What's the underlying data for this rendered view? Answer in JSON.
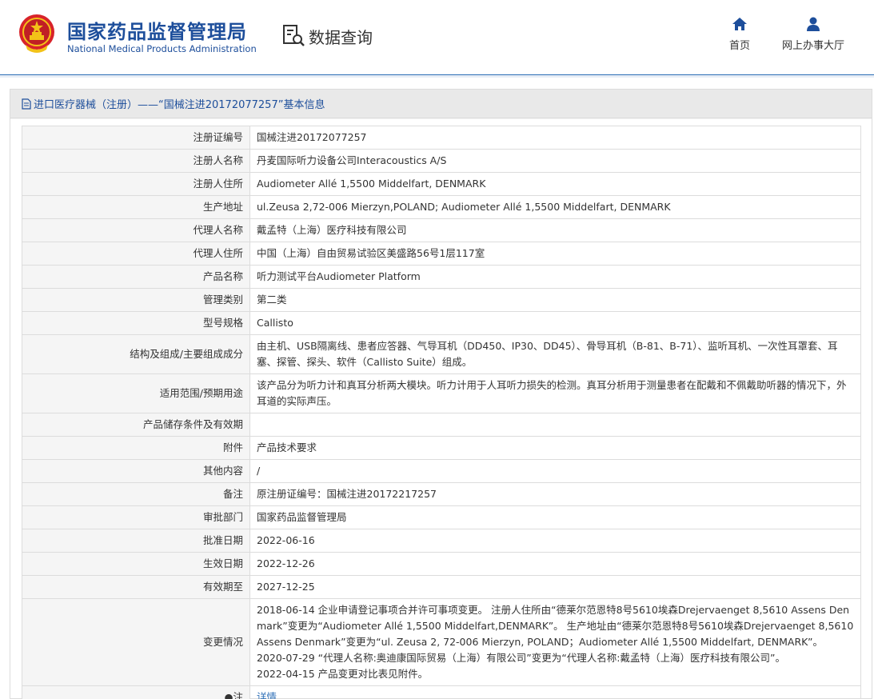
{
  "header": {
    "title_cn": "国家药品监督管理局",
    "title_en": "National Medical Products Administration",
    "query_label": "数据查询",
    "nav": [
      {
        "label": "首页",
        "icon": "home-icon"
      },
      {
        "label": "网上办事大厅",
        "icon": "user-icon"
      }
    ]
  },
  "panel": {
    "title": "进口医疗器械（注册）——“国械注进20172077257”基本信息"
  },
  "rows": [
    {
      "key": "注册证编号",
      "value": "国械注进20172077257"
    },
    {
      "key": "注册人名称",
      "value": "丹麦国际听力设备公司Interacoustics A/S"
    },
    {
      "key": "注册人住所",
      "value": "Audiometer Allé 1,5500 Middelfart, DENMARK"
    },
    {
      "key": "生产地址",
      "value": "ul.Zeusa 2,72-006 Mierzyn,POLAND; Audiometer Allé 1,5500 Middelfart, DENMARK"
    },
    {
      "key": "代理人名称",
      "value": "戴孟特（上海）医疗科技有限公司"
    },
    {
      "key": "代理人住所",
      "value": "中国（上海）自由贸易试验区美盛路56号1层117室"
    },
    {
      "key": "产品名称",
      "value": "听力测试平台Audiometer Platform"
    },
    {
      "key": "管理类别",
      "value": "第二类"
    },
    {
      "key": "型号规格",
      "value": "Callisto"
    },
    {
      "key": "结构及组成/主要组成成分",
      "value": "由主机、USB隔离线、患者应答器、气导耳机（DD450、IP30、DD45）、骨导耳机（B-81、B-71）、监听耳机、一次性耳罩套、耳塞、探管、探头、软件（Callisto Suite）组成。"
    },
    {
      "key": "适用范围/预期用途",
      "value": "该产品分为听力计和真耳分析两大模块。听力计用于人耳听力损失的检测。真耳分析用于测量患者在配戴和不佩戴助听器的情况下，外耳道的实际声压。"
    },
    {
      "key": "产品储存条件及有效期",
      "value": ""
    },
    {
      "key": "附件",
      "value": "产品技术要求"
    },
    {
      "key": "其他内容",
      "value": "/"
    },
    {
      "key": "备注",
      "value": "原注册证编号：国械注进20172217257"
    },
    {
      "key": "审批部门",
      "value": "国家药品监督管理局"
    },
    {
      "key": "批准日期",
      "value": "2022-06-16"
    },
    {
      "key": "生效日期",
      "value": "2022-12-26"
    },
    {
      "key": "有效期至",
      "value": "2027-12-25"
    },
    {
      "key": "变更情况",
      "lines": [
        "2018-06-14 企业申请登记事项合并许可事项变更。 注册人住所由“德莱尔范恩特8号5610埃森Drejervaenget 8,5610 Assens Denmark”变更为“Audiometer Allé 1,5500 Middelfart,DENMARK”。 生产地址由“德莱尔范恩特8号5610埃森Drejervaenget 8,5610 Assens Denmark”变更为“ul. Zeusa 2, 72-006 Mierzyn, POLAND；Audiometer Allé 1,5500 Middelfart, DENMARK”。",
        "2020-07-29 “代理人名称:奥迪康国际贸易（上海）有限公司”变更为“代理人名称:戴孟特（上海）医疗科技有限公司”。",
        "2022-04-15 产品变更对比表见附件。"
      ]
    },
    {
      "key": "●注",
      "value": "详情"
    }
  ],
  "colors": {
    "brand": "#1d4e9b",
    "link": "#2e6fb7",
    "key_bg": "#f5f5f5",
    "border": "#dcdcdc"
  }
}
